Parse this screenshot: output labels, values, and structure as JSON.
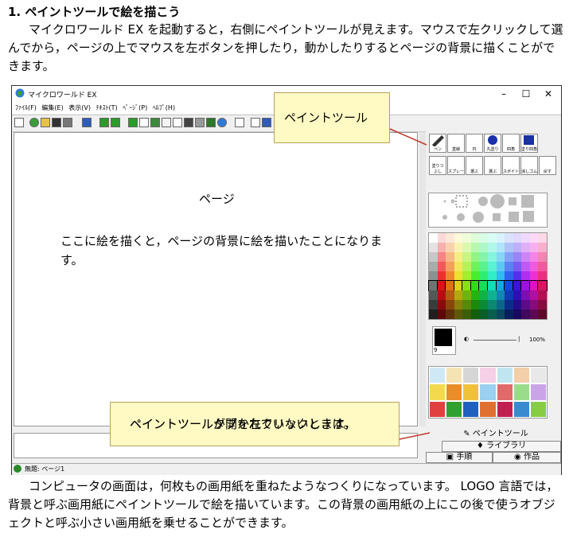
{
  "heading": "1. ペイントツールで絵を描こう",
  "paragraph1": "マイクロワールド EX を起動すると，右側にペイントツールが見えます。マウスで左クリックして選んでから，ページの上でマウスを左ボタンを押したり，動かしたりするとページの背景に描くことができます。",
  "paragraph2": "コンピュータの画面は，何枚もの画用紙を重ねたようなつくりになっています。 LOGO 言語では，背景と呼ぶ画用紙にペイントツールで絵を描いています。この背景の画用紙の上にこの後で使うオブジェクトと呼ぶ小さい画用紙を乗せることができます。",
  "window": {
    "title": "マイクロワールド EX",
    "controls": [
      "–",
      "☐",
      "✕"
    ],
    "menu": [
      "ﾌｧｲﾙ(F)",
      "編集(E)",
      "表示(V)",
      "ﾃｷｽﾄ(T)",
      "ﾍﾟｰｼﾞ(P)",
      "ﾍﾙﾌﾟ(H)"
    ],
    "page_label": "ページ",
    "page_description": "ここに絵を描くと，ページの背景に絵を描いたことになります。",
    "status": "無題: ページ1"
  },
  "paint_panel": {
    "tools_row1": [
      "ペン",
      "直線",
      "円",
      "丸塗り",
      "四角",
      "塗り四角"
    ],
    "tools_row2": [
      "塗りつぶし",
      "スプレー",
      "選ぶ",
      "選ぶ",
      "スポイト",
      "消しゴム",
      "戻す"
    ],
    "swatch_number": "9",
    "opacity": "100%",
    "tabs": {
      "paint": "ペイントツール",
      "library": "ライブラリ",
      "procedure": "手順",
      "works": "作品"
    }
  },
  "callouts": {
    "paint_tool": "ペイントツール",
    "tip_line1": "ペイントツールが開かれていないときは，",
    "tip_line2": "ペイントツールタブを左クリックします。"
  },
  "colors": {
    "callout_bg": "#fff9c4",
    "callout_arrow": "#c0392b"
  }
}
